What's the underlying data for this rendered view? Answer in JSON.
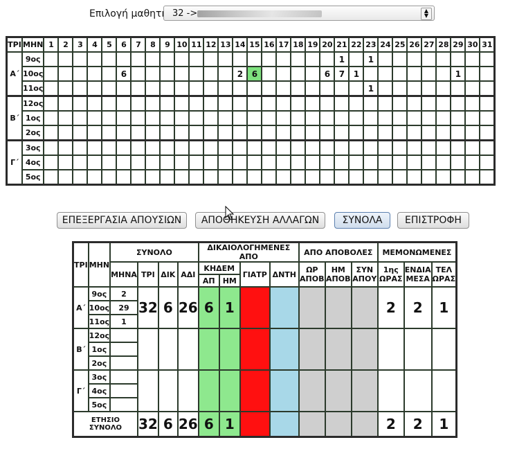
{
  "selector": {
    "label": "Επιλογή μαθητή:",
    "value": "32 ->"
  },
  "calendar": {
    "header_tri": "ΤΡΙ",
    "header_mhn": "ΜΗΝ",
    "days": [
      "1",
      "2",
      "3",
      "4",
      "5",
      "6",
      "7",
      "8",
      "9",
      "10",
      "11",
      "12",
      "13",
      "14",
      "15",
      "16",
      "17",
      "18",
      "19",
      "20",
      "21",
      "22",
      "23",
      "24",
      "25",
      "26",
      "27",
      "28",
      "29",
      "30",
      "31"
    ],
    "groups": [
      {
        "label": "Α΄",
        "months": [
          {
            "label": "9ος",
            "values": {
              "21": "1",
              "23": "1"
            }
          },
          {
            "label": "10ος",
            "values": {
              "6": "6",
              "14": "2",
              "15": "6",
              "20": "6",
              "21": "7",
              "22": "1",
              "29": "1"
            },
            "highlight": [
              "15"
            ]
          },
          {
            "label": "11ος",
            "values": {
              "23": "1"
            }
          }
        ]
      },
      {
        "label": "Β΄",
        "months": [
          {
            "label": "12ος",
            "values": {}
          },
          {
            "label": "1ος",
            "values": {}
          },
          {
            "label": "2ος",
            "values": {}
          }
        ]
      },
      {
        "label": "Γ΄",
        "months": [
          {
            "label": "3ος",
            "values": {}
          },
          {
            "label": "4ος",
            "values": {}
          },
          {
            "label": "5ος",
            "values": {}
          }
        ]
      }
    ]
  },
  "buttons": {
    "edit": "ΕΠΕΞΕΡΓΑΣΙΑ ΑΠΟΥΣΙΩΝ",
    "save": "ΑΠΟΘΗΚΕΥΣΗ ΑΛΛΑΓΩΝ",
    "totals": "ΣΥΝΟΛΑ",
    "back": "ΕΠΙΣΤΡΟΦΗ"
  },
  "summary": {
    "headers": {
      "tri": "ΤΡΙ",
      "mhn": "ΜΗΝ",
      "synolo": "ΣΥΝΟΛΟ",
      "dikaiologimenes": "ΔΙΚΑΙΟΛΟΓΗΜΕΝΕΣ ΑΠΟ",
      "apovoles": "ΑΠΟ ΑΠΟΒΟΛΕΣ",
      "memonomenes": "ΜΕΜΟΝΩΜΕΝΕΣ",
      "mhna": "ΜΗΝΑ",
      "tri2": "ΤΡΙ",
      "dik": "ΔΙΚ",
      "adi": "ΑΔΙ",
      "khdem": "ΚΗΔΕΜ",
      "ap": "ΑΠ",
      "hm": "ΗΜ",
      "giatr": "ΓΙΑΤΡ",
      "dnth": "ΔΝΤΗ",
      "or1": "ΩΡ",
      "or2": "ΑΠΟΒ",
      "hm1": "ΗΜ",
      "hm2": "ΑΠΟΒ",
      "syn1": "ΣΥΝ",
      "syn2": "ΑΠΟΥ",
      "pr1": "1ης",
      "pr2": "ΩΡΑΣ",
      "en1": "ΕΝΔΙΑ",
      "en2": "ΜΕΣΑ",
      "tel1": "ΤΕΛ",
      "tel2": "ΩΡΑΣ"
    },
    "groups": [
      {
        "label": "Α΄",
        "months": [
          {
            "label": "9ος",
            "total": "2"
          },
          {
            "label": "10ος",
            "total": "29"
          },
          {
            "label": "11ος",
            "total": "1"
          }
        ],
        "tri": "32",
        "dik": "6",
        "adi": "26",
        "ap": "6",
        "hm": "1",
        "pr": "2",
        "en": "2",
        "tel": "1"
      },
      {
        "label": "Β΄",
        "months": [
          {
            "label": "12ος",
            "total": ""
          },
          {
            "label": "1ος",
            "total": ""
          },
          {
            "label": "2ος",
            "total": ""
          }
        ],
        "tri": "",
        "dik": "",
        "adi": "",
        "ap": "",
        "hm": "",
        "pr": "",
        "en": "",
        "tel": ""
      },
      {
        "label": "Γ΄",
        "months": [
          {
            "label": "3ος",
            "total": ""
          },
          {
            "label": "4ος",
            "total": ""
          },
          {
            "label": "5ος",
            "total": ""
          }
        ],
        "tri": "",
        "dik": "",
        "adi": "",
        "ap": "",
        "hm": "",
        "pr": "",
        "en": "",
        "tel": ""
      }
    ],
    "annual": {
      "label1": "ΕΤΗΣΙΟ",
      "label2": "ΣΥΝΟΛΟ",
      "tri": "32",
      "dik": "6",
      "adi": "26",
      "ap": "6",
      "hm": "1",
      "pr": "2",
      "en": "2",
      "tel": "1"
    },
    "colors": {
      "green": "#8ee88e",
      "red": "#ff1010",
      "blue": "#a8d8e8",
      "grey": "#cfcfcf"
    }
  }
}
